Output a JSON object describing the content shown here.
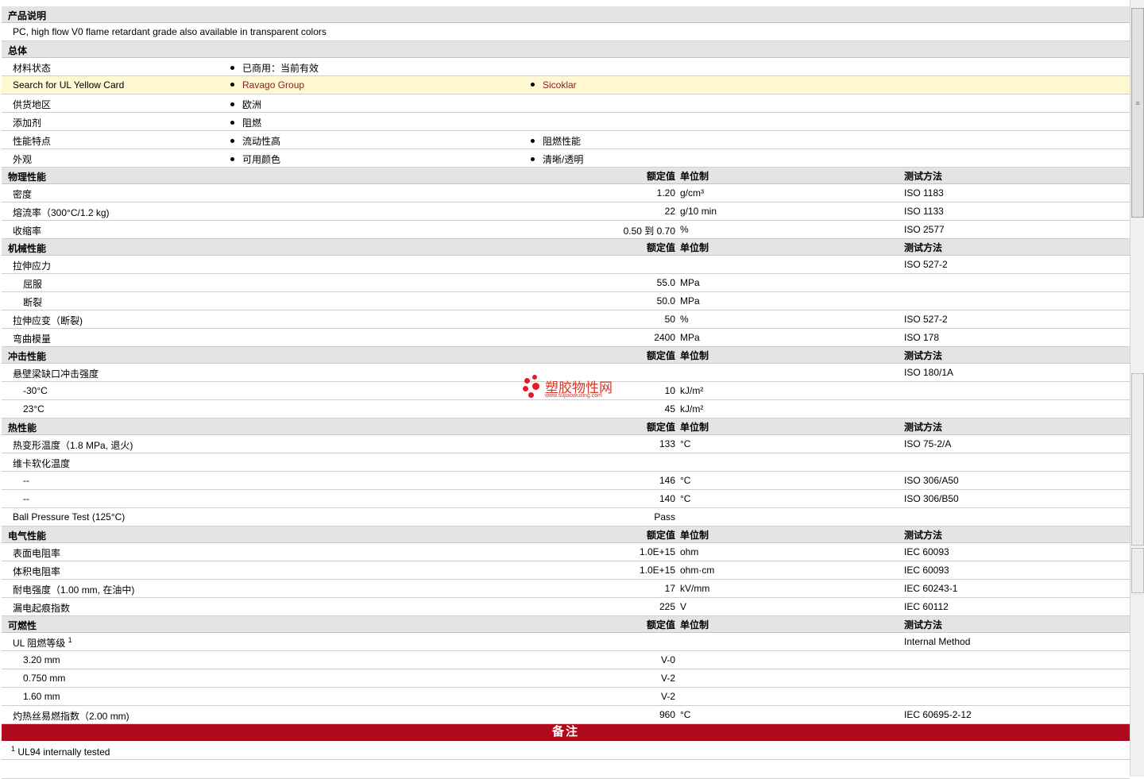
{
  "product": {
    "header": "产品说明",
    "description": "PC, high flow V0 flame retardant grade also available in transparent colors"
  },
  "general": {
    "header": "总体",
    "rows": [
      {
        "label": "材料状态",
        "items": [
          "已商用：当前有效"
        ]
      },
      {
        "label": "Search for UL Yellow Card",
        "items": [
          "Ravago Group",
          "Sicoklar"
        ]
      },
      {
        "label": "供货地区",
        "items": [
          "欧洲"
        ]
      },
      {
        "label": "添加剂",
        "items": [
          "阻燃"
        ]
      },
      {
        "label": "性能特点",
        "items": [
          "流动性高",
          "阻燃性能"
        ]
      },
      {
        "label": "外观",
        "items": [
          "可用颜色",
          "清晰/透明"
        ]
      }
    ]
  },
  "col_headers": {
    "value": "额定值",
    "unit": "单位制",
    "method": "测试方法"
  },
  "physical": {
    "title": "物理性能",
    "rows": [
      {
        "label": "密度",
        "value": "1.20",
        "unit": "g/cm³",
        "method": "ISO 1183"
      },
      {
        "label": "熔流率（300°C/1.2 kg)",
        "value": "22",
        "unit": "g/10 min",
        "method": "ISO 1133"
      },
      {
        "label": "收缩率",
        "value": "0.50 到  0.70",
        "unit": "%",
        "method": "ISO 2577"
      }
    ]
  },
  "mechanical": {
    "title": "机械性能",
    "rows": [
      {
        "label": "拉伸应力",
        "value": "",
        "unit": "",
        "method": "ISO 527-2"
      },
      {
        "label": "屈服",
        "value": "55.0",
        "unit": "MPa",
        "method": ""
      },
      {
        "label": "断裂",
        "value": "50.0",
        "unit": "MPa",
        "method": ""
      },
      {
        "label": "拉伸应变（断裂)",
        "value": "50",
        "unit": "%",
        "method": "ISO 527-2"
      },
      {
        "label": "弯曲模量",
        "value": "2400",
        "unit": "MPa",
        "method": "ISO 178"
      }
    ]
  },
  "impact": {
    "title": "冲击性能",
    "rows": [
      {
        "label": "悬壁梁缺口冲击强度",
        "value": "",
        "unit": "",
        "method": "ISO 180/1A"
      },
      {
        "label": "-30°C",
        "value": "10",
        "unit": "kJ/m²",
        "method": ""
      },
      {
        "label": "23°C",
        "value": "45",
        "unit": "kJ/m²",
        "method": ""
      }
    ]
  },
  "thermal": {
    "title": "热性能",
    "rows": [
      {
        "label": "热变形温度（1.8 MPa, 退火)",
        "value": "133",
        "unit": "°C",
        "method": "ISO 75-2/A"
      },
      {
        "label": "维卡软化温度",
        "value": "",
        "unit": "",
        "method": ""
      },
      {
        "label": "--",
        "value": "146",
        "unit": "°C",
        "method": "ISO 306/A50"
      },
      {
        "label": "--",
        "value": "140",
        "unit": "°C",
        "method": "ISO 306/B50"
      },
      {
        "label": "Ball Pressure Test (125°C)",
        "value": "Pass",
        "unit": "",
        "method": ""
      }
    ]
  },
  "electrical": {
    "title": "电气性能",
    "rows": [
      {
        "label": "表面电阻率",
        "value": "1.0E+15",
        "unit": "ohm",
        "method": "IEC 60093"
      },
      {
        "label": "体积电阻率",
        "value": "1.0E+15",
        "unit": "ohm·cm",
        "method": "IEC 60093"
      },
      {
        "label": "耐电强度（1.00 mm, 在油中)",
        "value": "17",
        "unit": "kV/mm",
        "method": "IEC 60243-1"
      },
      {
        "label": "漏电起痕指数",
        "value": "225",
        "unit": "V",
        "method": "IEC 60112"
      }
    ]
  },
  "flammability": {
    "title": "可燃性",
    "rows": [
      {
        "label": "UL 阻燃等级",
        "sup": "1",
        "value": "",
        "unit": "",
        "method": "Internal Method"
      },
      {
        "label": "3.20 mm",
        "value": "V-0",
        "unit": "",
        "method": ""
      },
      {
        "label": "0.750 mm",
        "value": "V-2",
        "unit": "",
        "method": ""
      },
      {
        "label": "1.60 mm",
        "value": "V-2",
        "unit": "",
        "method": ""
      },
      {
        "label": "灼热丝易燃指数（2.00 mm)",
        "value": "960",
        "unit": "°C",
        "method": "IEC 60695-2-12"
      }
    ]
  },
  "notes": {
    "title": "备注",
    "items": [
      {
        "num": "1",
        "text": "UL94 internally tested"
      }
    ]
  },
  "watermark": {
    "text": "塑胶物性网",
    "url": "www.sujiaowuxing.com"
  },
  "colors": {
    "notes_bar": "#b0091c",
    "link": "#8a1e1e",
    "section_bg": "#e4e4e4",
    "highlight_row": "#fff8d3"
  }
}
